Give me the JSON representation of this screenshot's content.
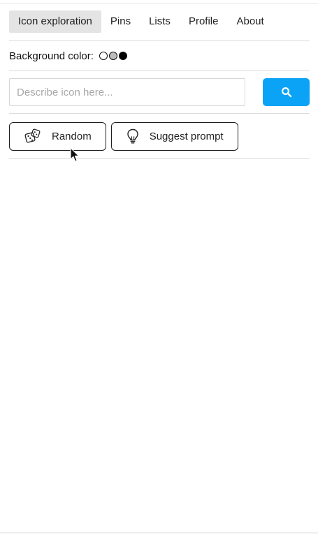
{
  "nav": {
    "items": [
      {
        "label": "Icon exploration",
        "active": true
      },
      {
        "label": "Pins",
        "active": false
      },
      {
        "label": "Lists",
        "active": false
      },
      {
        "label": "Profile",
        "active": false
      },
      {
        "label": "About",
        "active": false
      }
    ]
  },
  "background": {
    "label": "Background color:",
    "swatches": [
      {
        "name": "white",
        "color": "#ffffff"
      },
      {
        "name": "gray",
        "color": "#bdbdbd"
      },
      {
        "name": "black",
        "color": "#000000"
      }
    ]
  },
  "search": {
    "placeholder": "Describe icon here...",
    "value": "",
    "button_icon": "search-icon",
    "button_color": "#0aa3f5"
  },
  "actions": {
    "random_label": "Random",
    "random_icon": "dice-icon",
    "suggest_label": "Suggest prompt",
    "suggest_icon": "lightbulb-icon"
  },
  "colors": {
    "accent": "#0aa3f5",
    "active_tab_bg": "#e4e4e4",
    "divider": "#dcdcdc"
  }
}
